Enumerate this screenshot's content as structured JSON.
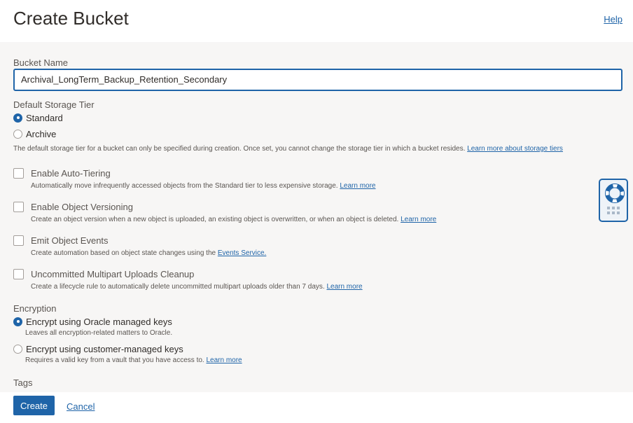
{
  "header": {
    "title": "Create Bucket",
    "help_label": "Help"
  },
  "bucket_name": {
    "label": "Bucket Name",
    "value": "Archival_LongTerm_Backup_Retention_Secondary"
  },
  "storage_tier": {
    "label": "Default Storage Tier",
    "options": [
      {
        "label": "Standard",
        "selected": true
      },
      {
        "label": "Archive",
        "selected": false
      }
    ],
    "note": "The default storage tier for a bucket can only be specified during creation. Once set, you cannot change the storage tier in which a bucket resides.",
    "note_link": "Learn more about storage tiers"
  },
  "options": [
    {
      "label": "Enable Auto-Tiering",
      "checked": false,
      "description": "Automatically move infrequently accessed objects from the Standard tier to less expensive storage.",
      "link": "Learn more"
    },
    {
      "label": "Enable Object Versioning",
      "checked": false,
      "description": "Create an object version when a new object is uploaded, an existing object is overwritten, or when an object is deleted.",
      "link": "Learn more"
    },
    {
      "label": "Emit Object Events",
      "checked": false,
      "description": "Create automation based on object state changes using the",
      "link": "Events Service."
    },
    {
      "label": "Uncommitted Multipart Uploads Cleanup",
      "checked": false,
      "description": "Create a lifecycle rule to automatically delete uncommitted multipart uploads older than 7 days.",
      "link": "Learn more"
    }
  ],
  "encryption": {
    "label": "Encryption",
    "options": [
      {
        "label": "Encrypt using Oracle managed keys",
        "selected": true,
        "description": "Leaves all encryption-related matters to Oracle.",
        "link": ""
      },
      {
        "label": "Encrypt using customer-managed keys",
        "selected": false,
        "description": "Requires a valid key from a vault that you have access to.",
        "link": "Learn more"
      }
    ]
  },
  "tags": {
    "label": "Tags"
  },
  "footer": {
    "create_label": "Create",
    "cancel_label": "Cancel"
  },
  "help_widget": {
    "icon": "lifebuoy-icon"
  },
  "colors": {
    "accent": "#1f64a8",
    "background": "#f7f6f5",
    "text": "#312d2a"
  }
}
